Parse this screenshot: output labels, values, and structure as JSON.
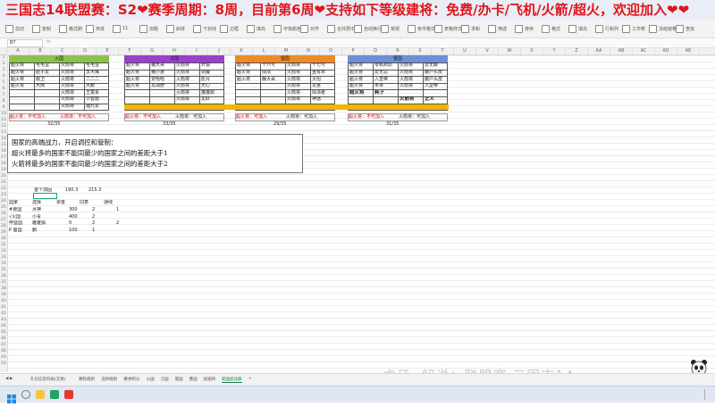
{
  "banner": {
    "text": "三国志14联盟赛：S2❤赛季周期：8周，目前第6周❤支持如下等级建将：免费/办卡/飞机/火箭/超火，欢迎加入❤❤"
  },
  "ribbon": {
    "items": [
      "剪切",
      "复制",
      "格式刷",
      "宋体",
      "11",
      "加粗",
      "斜体",
      "下划线",
      "边框",
      "填充",
      "字体颜色",
      "对齐",
      "合并居中",
      "自动换行",
      "常规",
      "条件格式",
      "表格样式",
      "求和",
      "筛选",
      "排序",
      "格式",
      "填充",
      "行和列",
      "工作表",
      "冻结窗格",
      "查找"
    ]
  },
  "formula_bar": {
    "name_box": "B7",
    "fx": "fx"
  },
  "columns": [
    "A",
    "B",
    "C",
    "D",
    "E",
    "F",
    "G",
    "H",
    "I",
    "J",
    "K",
    "L",
    "M",
    "N",
    "O",
    "P",
    "Q",
    "R",
    "S",
    "T",
    "U",
    "V",
    "W",
    "X",
    "Y",
    "Z",
    "AA",
    "AB",
    "AC",
    "AD",
    "AE",
    "AF"
  ],
  "rows": [
    "1",
    "2",
    "3",
    "4",
    "5",
    "6",
    "7",
    "8",
    "9",
    "10",
    "11",
    "12",
    "13",
    "14",
    "15",
    "16",
    "17",
    "18",
    "19",
    "20",
    "21",
    "22",
    "23",
    "24",
    "25",
    "26",
    "27",
    "28",
    "29",
    "30",
    "31",
    "32",
    "33",
    "34",
    "35",
    "36",
    "37",
    "38",
    "39",
    "40",
    "41",
    "42",
    "43",
    "44",
    "45",
    "46",
    "47",
    "48",
    "49",
    "50"
  ],
  "countries": [
    {
      "name": "火国",
      "color": "#8bc34a",
      "rows": [
        [
          "超火将",
          "毛毛虫",
          "火箭将",
          "毛毛虫"
        ],
        [
          "超火将",
          "赵子龙",
          "火箭将",
          "李大嘴"
        ],
        [
          "超火将",
          "顺卫",
          "火箭将",
          "二二二"
        ],
        [
          "超火将",
          "大熊",
          "火箭将",
          "大鹏"
        ],
        [
          "",
          "",
          "火箭将",
          "王富贵"
        ],
        [
          "",
          "",
          "火箭将",
          "小智能"
        ],
        [
          "",
          "",
          "火箭将",
          "烟九爱"
        ]
      ],
      "footer_left": "超火将：不可加入",
      "footer_right": "火箭将：不可加入",
      "count": "32/35"
    },
    {
      "name": "汉国",
      "color": "#9c3fd0",
      "rows": [
        [
          "超火将",
          "猪大哥",
          "火箭将",
          "轩辕"
        ],
        [
          "超火将",
          "猪小弟",
          "火箭将",
          "剑魔"
        ],
        [
          "超火将",
          "安哈哈",
          "火箭将",
          "影月"
        ],
        [
          "超火将",
          "龙战野",
          "火箭将",
          "无心"
        ],
        [
          "",
          "",
          "火箭将",
          "猫猫狗"
        ],
        [
          "",
          "",
          "火箭将",
          "龙虾"
        ],
        [
          "",
          "",
          "",
          ""
        ]
      ],
      "footer_left": "超火将：不可加入",
      "footer_right": "火箭将：可加入",
      "count": "33/35"
    },
    {
      "name": "蜀国",
      "color": "#f08a24",
      "rows": [
        [
          "超火将",
          "十六号",
          "火箭将",
          "十七号"
        ],
        [
          "超火将",
          "情浓",
          "火箭将",
          "虽有寒"
        ],
        [
          "超火将",
          "静大哥",
          "火箭将",
          "大招"
        ],
        [
          "",
          "",
          "火箭将",
          "龙宫"
        ],
        [
          "",
          "",
          "火箭将",
          "情浓者"
        ],
        [
          "",
          "",
          "火箭将",
          "神话"
        ],
        [
          "",
          "",
          "",
          ""
        ]
      ],
      "footer_left": "超火将：可加入",
      "footer_right": "火箭将：可加入",
      "count": "29/35"
    },
    {
      "name": "曹国",
      "color": "#6d8fd6",
      "rows": [
        [
          "超火将",
          "零帆疯原",
          "火箭将",
          "爱无聊"
        ],
        [
          "超火将",
          "爱无忌",
          "火箭将",
          "撒户头皮"
        ],
        [
          "超火将",
          "入皇帝",
          "火箭将",
          "撒户头皮"
        ],
        [
          "超火将",
          "朱将",
          "火箭将",
          "入皇帝"
        ],
        [
          "超火将",
          "耗子",
          "",
          ""
        ],
        [
          "",
          "",
          "火箭将",
          "正义"
        ],
        [
          "",
          "",
          "",
          ""
        ]
      ],
      "footer_left": "超火将：不可加入",
      "footer_right": "火箭将：可加入",
      "count": "31/35"
    }
  ],
  "message": {
    "lines": [
      "国家的高端战力，开启调控和管制：",
      "超火将最多的国家不能同最少的国家之间的差距大于1",
      "火箭将最多的国家不能同最少的国家之间的差距大于2"
    ]
  },
  "summary": {
    "label": "首个加固",
    "v1": "190.3",
    "v2": "215.3",
    "headers": [
      "国家",
      "选择",
      "资金",
      "同意",
      "通线"
    ],
    "rows": [
      [
        "#曹国",
        "月神",
        "300",
        "2",
        "1"
      ],
      [
        "√火国",
        "小青",
        "400",
        "2",
        ""
      ],
      [
        "申益国",
        "雄雄狐",
        "0",
        "2",
        "2"
      ],
      [
        "P 蜀国",
        "鹏",
        "100",
        "1",
        ""
      ]
    ]
  },
  "sheets": [
    "礼包信息列表(交易)",
    "赛程规则",
    "选将规则",
    "赛季积分",
    "火国",
    "汉国",
    "蜀国",
    "曹国",
    "加速将",
    "新国加注册",
    "+"
  ],
  "watermark": "虎牙 ·解说：联盟赛 三国志14",
  "status": {
    "zoom": "100%"
  }
}
